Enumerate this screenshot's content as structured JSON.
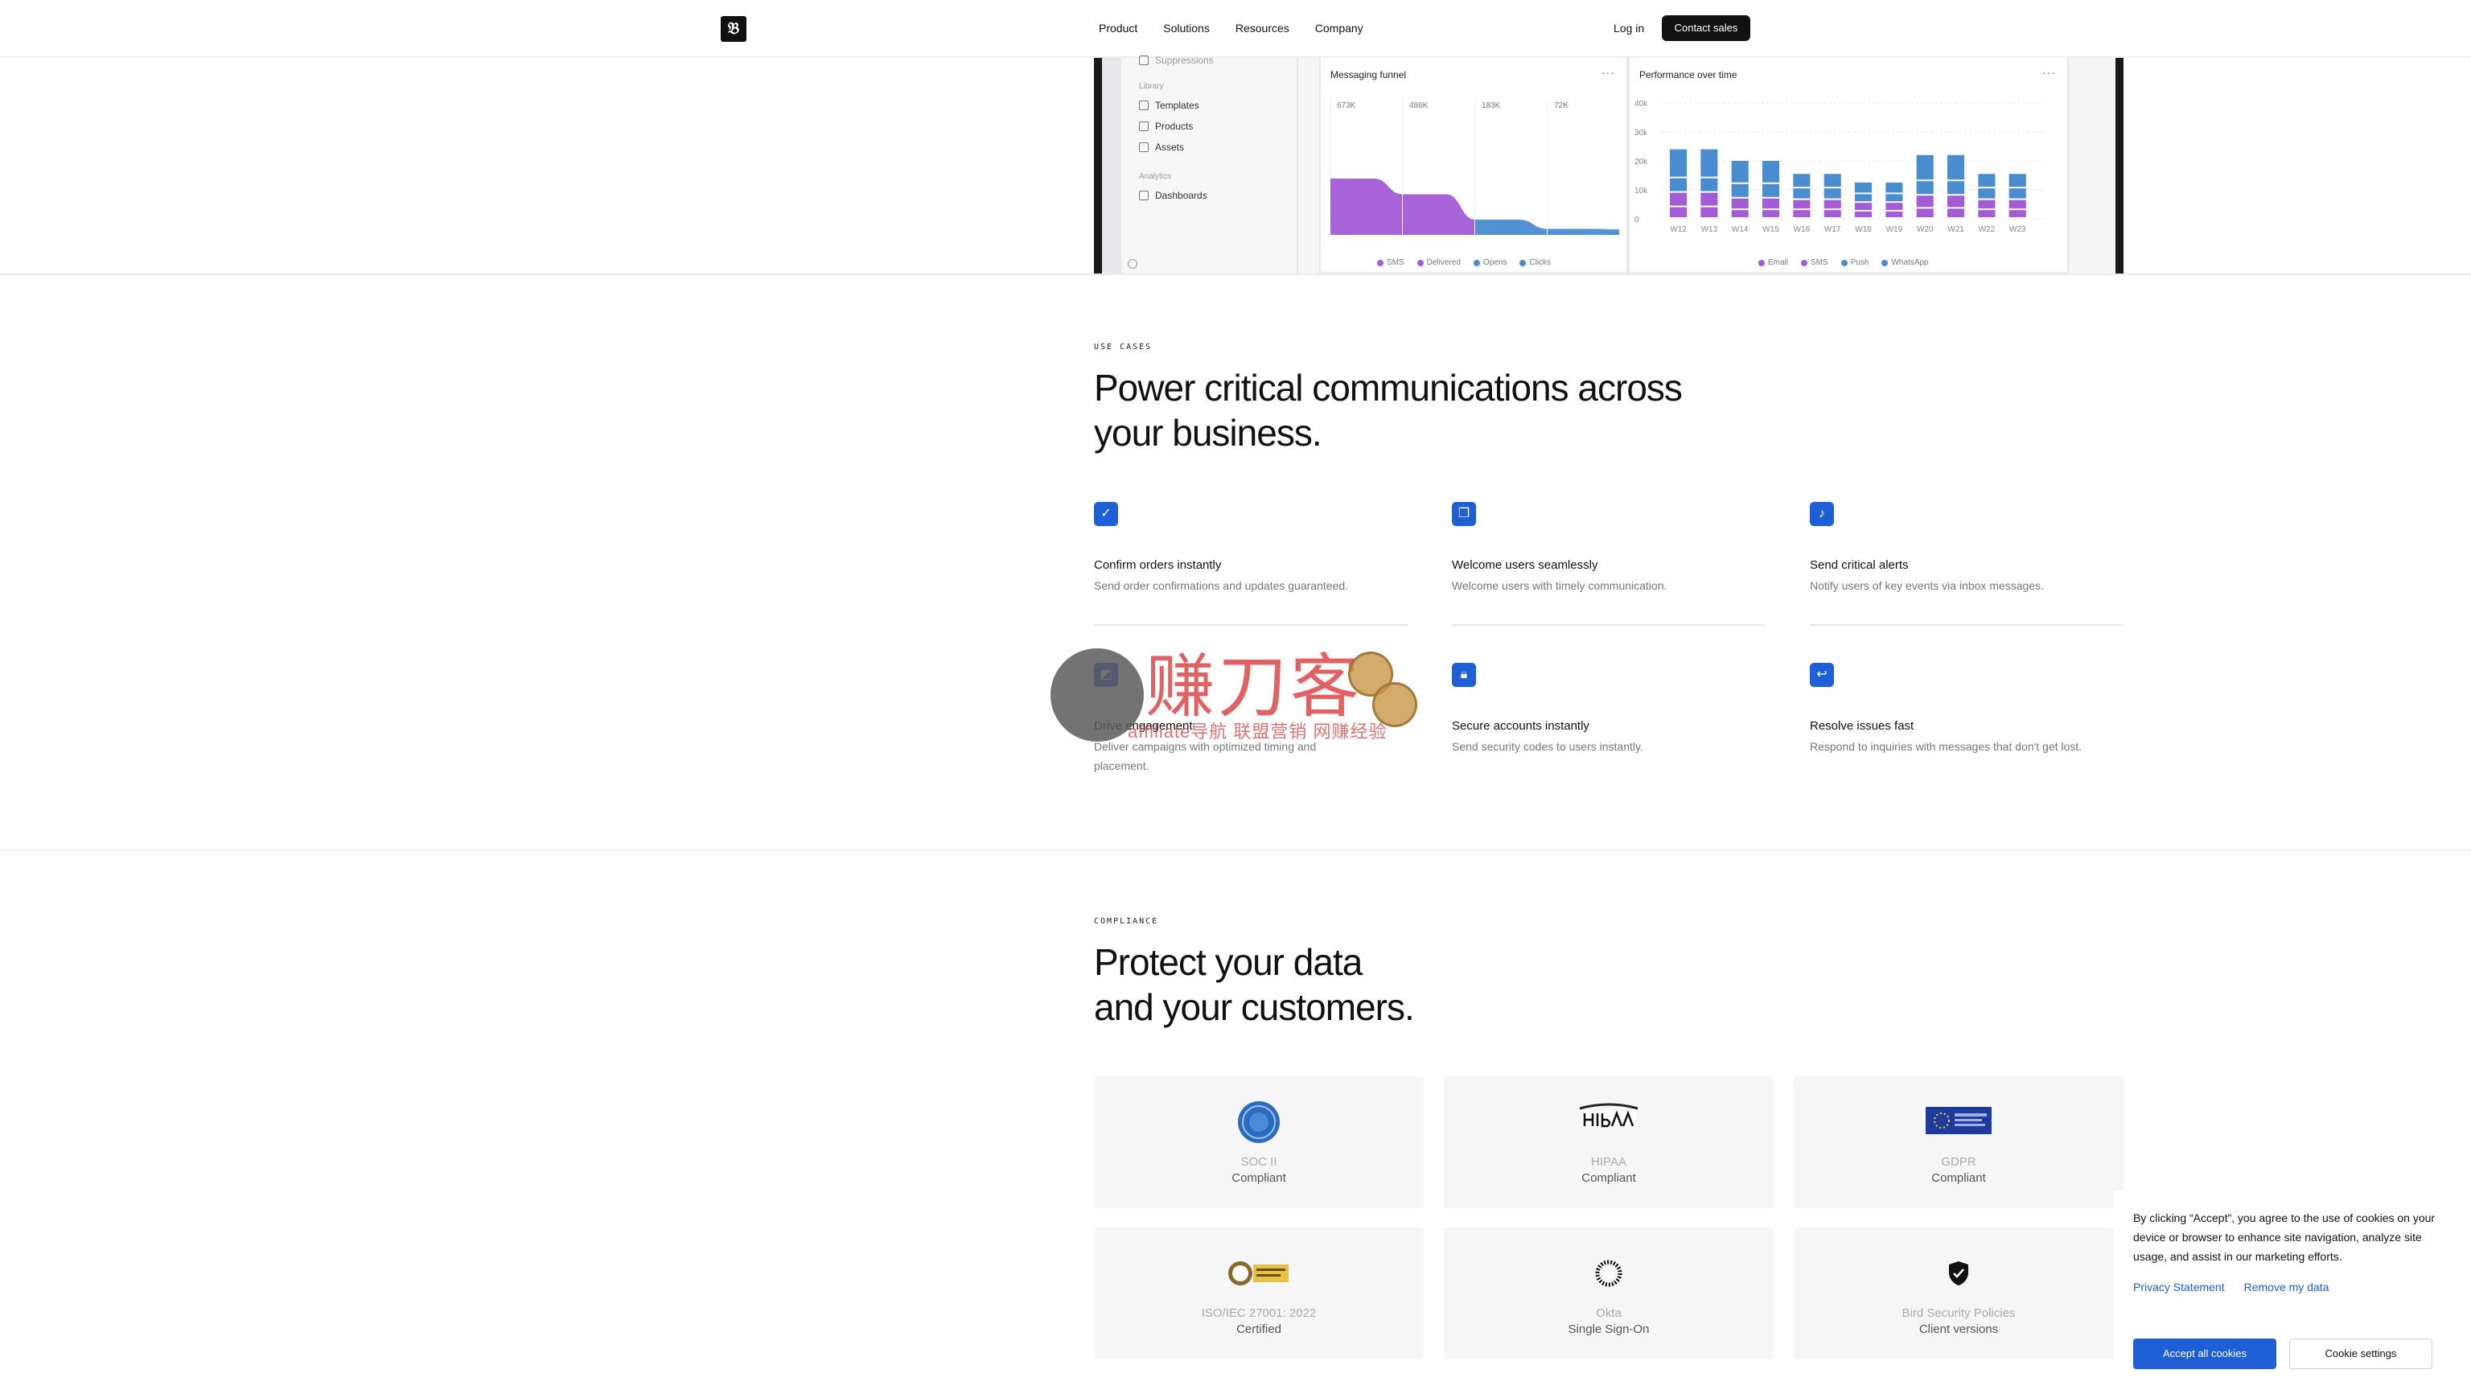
{
  "nav": {
    "links": [
      "Product",
      "Solutions",
      "Resources",
      "Company"
    ],
    "login": "Log in",
    "contact": "Contact sales"
  },
  "dashboard": {
    "sidebar": {
      "cut_item": "Suppressions",
      "library_label": "Library",
      "library_items": [
        "Templates",
        "Products",
        "Assets"
      ],
      "analytics_label": "Analytics",
      "analytics_items": [
        "Dashboards"
      ]
    },
    "funnel": {
      "title": "Messaging funnel",
      "values_labels": [
        "673K",
        "486K",
        "183K",
        "72K"
      ],
      "legend": [
        "SMS",
        "Delivered",
        "Opens",
        "Clicks"
      ]
    },
    "performance": {
      "title": "Performance over time",
      "legend": [
        "Email",
        "SMS",
        "Push",
        "WhatsApp"
      ]
    }
  },
  "chart_data": [
    {
      "type": "area",
      "title": "Messaging funnel",
      "categories": [
        "SMS",
        "Delivered",
        "Opens",
        "Clicks"
      ],
      "values": [
        673000,
        486000,
        183000,
        72000
      ],
      "series": [
        {
          "name": "SMS",
          "color": "#a35bd6"
        },
        {
          "name": "Delivered",
          "color": "#a35bd6"
        },
        {
          "name": "Opens",
          "color": "#4a8cd0"
        },
        {
          "name": "Clicks",
          "color": "#4a8cd0"
        }
      ]
    },
    {
      "type": "bar",
      "title": "Performance over time",
      "categories": [
        "W12",
        "W13",
        "W14",
        "W15",
        "W16",
        "W17",
        "W18",
        "W19",
        "W20",
        "W21",
        "W22",
        "W23"
      ],
      "y_ticks": [
        "40k",
        "30k",
        "20k",
        "10k",
        "0"
      ],
      "ylim": [
        0,
        40000
      ],
      "series": [
        {
          "name": "Email",
          "values": [
            4000,
            4000,
            3000,
            3000,
            3000,
            3000,
            2500,
            2500,
            3500,
            3500,
            3000,
            3000
          ],
          "color": "#a35bd6"
        },
        {
          "name": "SMS",
          "values": [
            5000,
            5000,
            4000,
            4000,
            3500,
            3500,
            3000,
            3000,
            4500,
            4500,
            3500,
            3500
          ],
          "color": "#a35bd6"
        },
        {
          "name": "Push",
          "values": [
            5000,
            5000,
            5000,
            5000,
            4000,
            4000,
            3000,
            3000,
            5000,
            5000,
            4000,
            4000
          ],
          "color": "#4a8cd0"
        },
        {
          "name": "WhatsApp",
          "values": [
            10000,
            10000,
            8000,
            8000,
            5000,
            5000,
            4000,
            4000,
            9000,
            9000,
            5000,
            5000
          ],
          "color": "#4a8cd0"
        }
      ]
    }
  ],
  "use_cases": {
    "eyebrow": "USE CASES",
    "heading_line1": "Power critical communications across",
    "heading_line2": "your business.",
    "items": [
      {
        "title": "Confirm orders instantly",
        "desc": "Send order confirmations and updates guaranteed.",
        "icon": "check-icon"
      },
      {
        "title": "Welcome users seamlessly",
        "desc": "Welcome users with timely communication.",
        "icon": "chat-icon"
      },
      {
        "title": "Send critical alerts",
        "desc": "Notify users of key events via inbox messages.",
        "icon": "bell-icon"
      },
      {
        "title": "Drive engagement",
        "desc": "Deliver campaigns with optimized timing and",
        "desc2": "placement.",
        "icon": "megaphone-icon"
      },
      {
        "title": "Secure accounts instantly",
        "desc": "Send security codes to users instantly.",
        "icon": "lock-icon"
      },
      {
        "title": "Resolve issues fast",
        "desc": "Respond to inquiries with messages that don't get lost.",
        "icon": "reply-icon"
      }
    ]
  },
  "compliance": {
    "eyebrow": "COMPLIANCE",
    "heading_line1": "Protect your data",
    "heading_line2": "and your customers.",
    "cards": [
      {
        "title": "SOC II",
        "sub": "Compliant",
        "icon": "aicpa-seal-icon"
      },
      {
        "title": "HIPAA",
        "sub": "Compliant",
        "icon": "hipaa-logo-icon"
      },
      {
        "title": "GDPR",
        "sub": "Compliant",
        "icon": "eu-flag-icon"
      },
      {
        "title": "ISO/IEC 27001: 2022",
        "sub": "Certified",
        "icon": "iso-badge-icon"
      },
      {
        "title": "Okta",
        "sub": "Single Sign-On",
        "icon": "okta-logo-icon"
      },
      {
        "title": "Bird Security Policies",
        "sub": "Client versions",
        "icon": "shield-check-icon"
      }
    ]
  },
  "cookie": {
    "text": "By clicking “Accept”, you agree to the use of cookies on your device or browser to enhance site navigation, analyze site usage, and assist in our marketing efforts.",
    "privacy": "Privacy Statement",
    "remove": "Remove my data",
    "accept": "Accept all cookies",
    "settings": "Cookie settings"
  },
  "watermark": {
    "text": "赚刀客",
    "sub": "affiliate导航 联盟营销 网赚经验"
  }
}
